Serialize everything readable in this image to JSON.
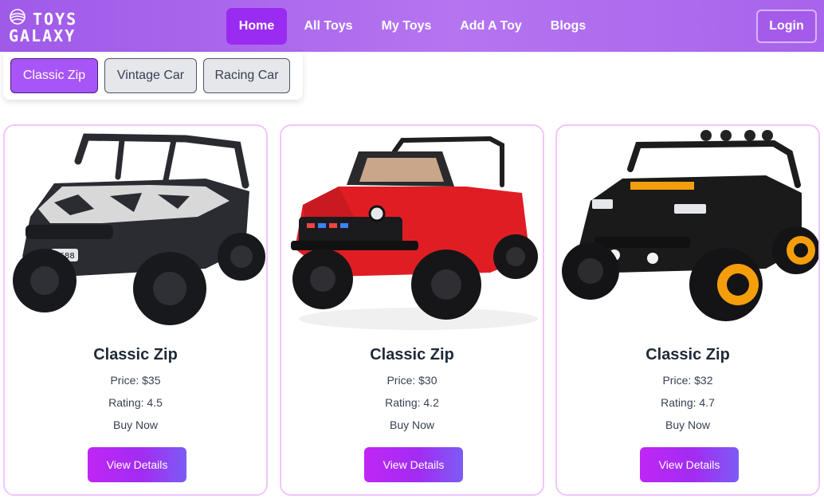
{
  "brand": {
    "line1": "TOYS",
    "line2": "GALAXY"
  },
  "nav": {
    "items": [
      {
        "label": "Home",
        "active": true
      },
      {
        "label": "All Toys",
        "active": false
      },
      {
        "label": "My Toys",
        "active": false
      },
      {
        "label": "Add A Toy",
        "active": false
      },
      {
        "label": "Blogs",
        "active": false
      }
    ],
    "login_label": "Login"
  },
  "tabs": [
    {
      "label": "Classic Zip",
      "active": true
    },
    {
      "label": "Vintage Car",
      "active": false
    },
    {
      "label": "Racing Car",
      "active": false
    }
  ],
  "cards": [
    {
      "name": "Classic Zip",
      "price": "Price: $35",
      "rating": "Rating: 4.5",
      "buy": "Buy Now",
      "button": "View Details",
      "toy_color": "#1f2024",
      "accent_color": "#c7c7c7"
    },
    {
      "name": "Classic Zip",
      "price": "Price: $30",
      "rating": "Rating: 4.2",
      "buy": "Buy Now",
      "button": "View Details",
      "toy_color": "#e11d24",
      "accent_color": "#111111"
    },
    {
      "name": "Classic Zip",
      "price": "Price: $32",
      "rating": "Rating: 4.7",
      "buy": "Buy Now",
      "button": "View Details",
      "toy_color": "#1a1a1a",
      "accent_color": "#f59e0b"
    }
  ],
  "colors": {
    "brand_purple": "#a855f7",
    "active_nav": "#9a2bf0",
    "button_gradient_start": "#c026f5",
    "button_gradient_end": "#7c5cf5",
    "card_border": "#f0c6fb"
  }
}
